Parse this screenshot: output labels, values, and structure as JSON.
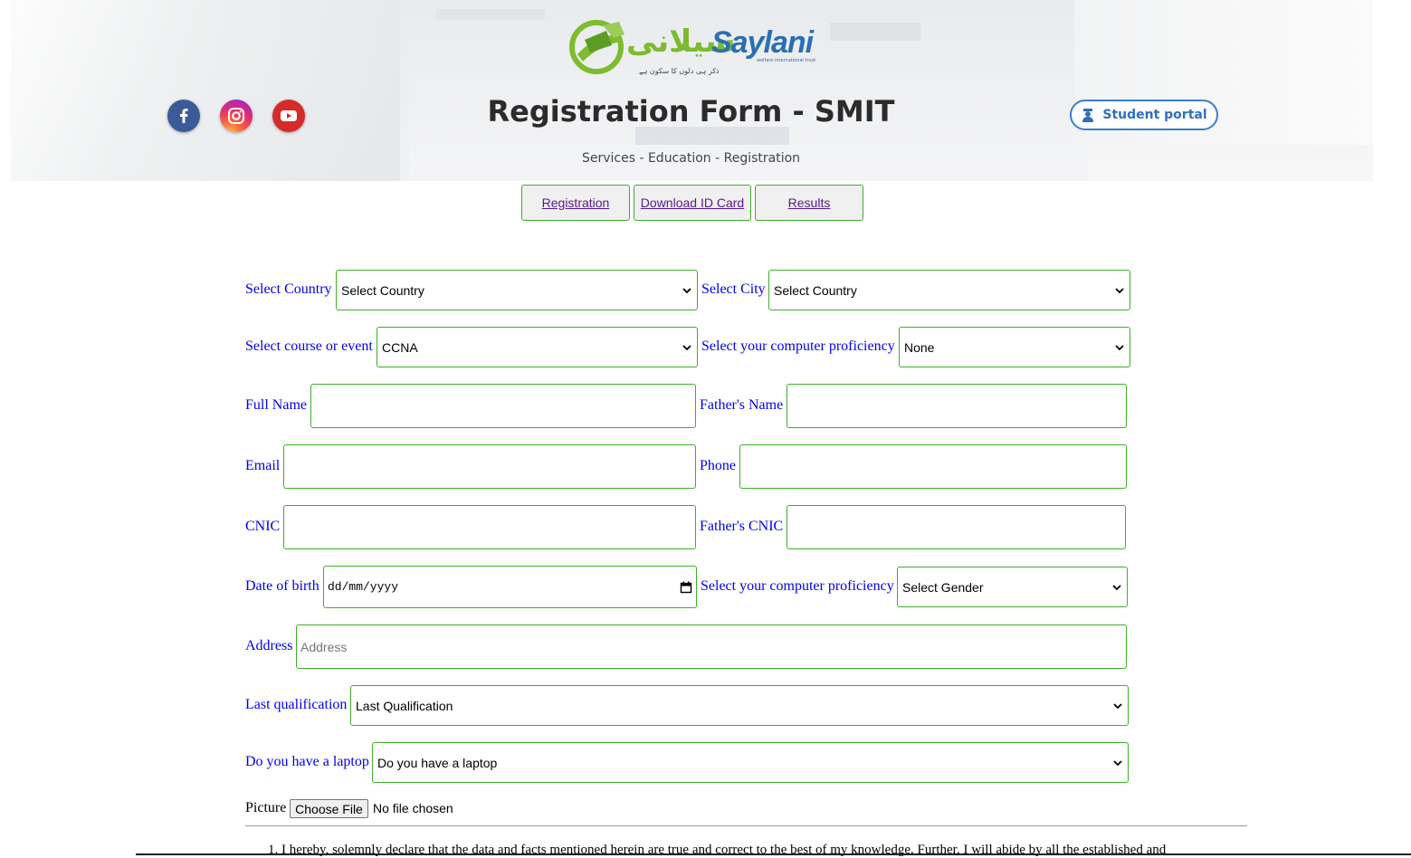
{
  "header": {
    "logo_text": "Saylani",
    "logo_urdu": "سیلانی",
    "logo_tagline": "ذکر ہی دلوں کا سکون ہے",
    "logo_subtagline": "welfare international trust",
    "title": "Registration Form - SMIT",
    "subtitle": "Services - Education - Registration",
    "student_portal_label": "Student portal",
    "social": [
      {
        "name": "facebook-icon",
        "glyph": "f"
      },
      {
        "name": "instagram-icon"
      },
      {
        "name": "youtube-icon"
      }
    ]
  },
  "nav": {
    "registration": "Registration",
    "download_id_card": "Download ID Card",
    "results": "Results"
  },
  "form": {
    "country_label": "Select Country",
    "country_value": "Select Country",
    "city_label": "Select City",
    "city_value": "Select Country",
    "course_label": "Select course or event",
    "course_value": "CCNA",
    "proficiency_label": "Select your computer proficiency",
    "proficiency_value": "None",
    "full_name_label": "Full Name",
    "father_name_label": "Father's Name",
    "email_label": "Email",
    "phone_label": "Phone",
    "cnic_label": "CNIC",
    "father_cnic_label": "Father's CNIC",
    "dob_label": "Date of birth",
    "dob_value": "dd/mm/yyyy",
    "gender_label": "Select your computer proficiency",
    "gender_value": "Select Gender",
    "address_label": "Address",
    "address_placeholder": "Address",
    "qualification_label": "Last qualification",
    "qualification_value": "Last Qualification",
    "laptop_label": "Do you have a laptop",
    "laptop_value": "Do you have a laptop",
    "picture_label": "Picture",
    "choose_file_label": "Choose File",
    "file_status": "No file chosen"
  },
  "declaration": "1. I hereby, solemnly declare that the data and facts mentioned herein are true and correct to the best of my knowledge. Further, I will abide by all the established and",
  "colors": {
    "field_border": "#3fae2a",
    "label_blue": "#0000ee",
    "portal_blue": "#3a7bd5",
    "link_purple": "#551a8b"
  }
}
